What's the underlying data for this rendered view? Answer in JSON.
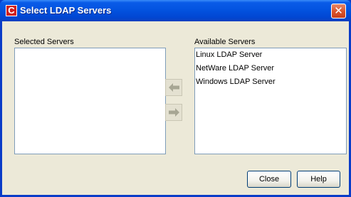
{
  "window": {
    "title": "Select LDAP Servers",
    "app_icon_glyph": "C",
    "close_glyph": "✕"
  },
  "selected": {
    "label": "Selected Servers",
    "items": []
  },
  "available": {
    "label": "Available Servers",
    "items": [
      "Linux LDAP Server",
      "NetWare LDAP Server",
      "Windows LDAP Server"
    ]
  },
  "buttons": {
    "add_icon": "arrow-left-icon",
    "remove_icon": "arrow-right-icon",
    "close": "Close",
    "help": "Help"
  },
  "colors": {
    "titlebar": "#0353e0",
    "client": "#ece9d8",
    "list_border": "#7f9db9",
    "disabled_arrow": "#a7a694"
  }
}
